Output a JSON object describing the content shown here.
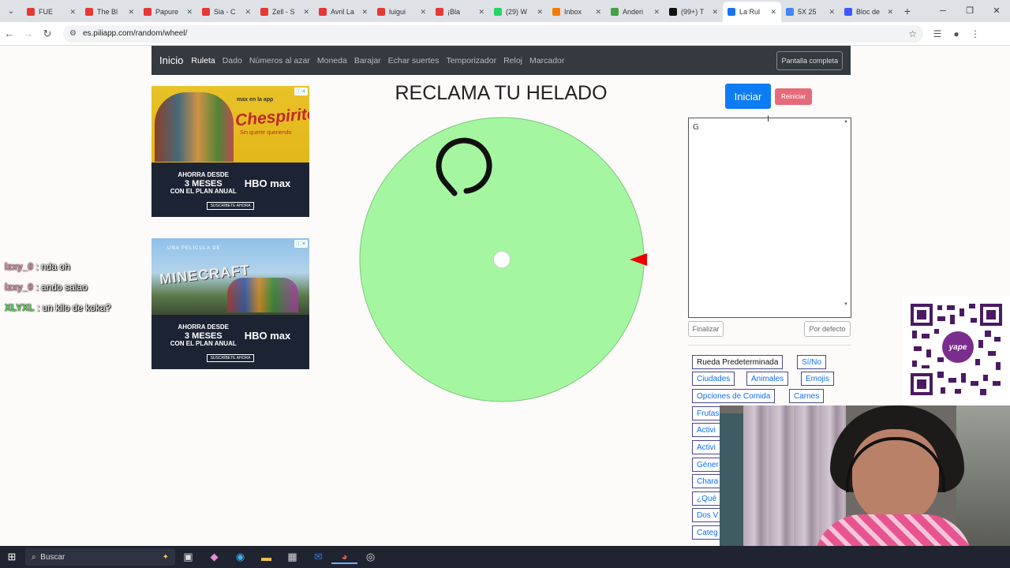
{
  "browser": {
    "tabs": [
      {
        "title": "FUE",
        "color": "#e53935"
      },
      {
        "title": "The Bl",
        "color": "#e53935"
      },
      {
        "title": "Papure",
        "color": "#e53935"
      },
      {
        "title": "Sia - C",
        "color": "#e53935"
      },
      {
        "title": "Zell - S",
        "color": "#e53935"
      },
      {
        "title": "Avril La",
        "color": "#e53935"
      },
      {
        "title": "luigui",
        "color": "#e53935"
      },
      {
        "title": "¡Bla",
        "color": "#e53935"
      },
      {
        "title": "(29) W",
        "color": "#25d366"
      },
      {
        "title": "Inbox",
        "color": "#f57c00"
      },
      {
        "title": "Anderi",
        "color": "#43a047"
      },
      {
        "title": "(99+) T",
        "color": "#111111"
      },
      {
        "title": "La Rul",
        "color": "#1a73e8"
      },
      {
        "title": "5X 25",
        "color": "#4285f4"
      },
      {
        "title": "Bloc de",
        "color": "#3d5afe"
      }
    ],
    "active_tab_index": 12,
    "url": "es.piliapp.com/random/wheel/"
  },
  "navbar": {
    "brand": "Inicio",
    "links": [
      "Ruleta",
      "Dado",
      "Números al azar",
      "Moneda",
      "Barajar",
      "Echar suertes",
      "Temporizador",
      "Reloj",
      "Marcador"
    ],
    "fullscreen": "Pantalla completa"
  },
  "ads": [
    {
      "mini": "max en la app",
      "title": "Chespirito",
      "tagline": "Sin querer queriendo",
      "offer_line1": "AHORRA DESDE",
      "offer_big": "3 MESES",
      "offer_line2": "CON EL PLAN ANUAL",
      "brand": "HBO max",
      "cta": "SUSCRÍBETE AHORA"
    },
    {
      "pre": "UNA PELÍCULA DE",
      "title": "MINECRAFT",
      "offer_line1": "AHORRA DESDE",
      "offer_big": "3 MESES",
      "offer_line2": "CON EL PLAN ANUAL",
      "brand": "HBO max",
      "cta": "SUSCRÍBETE AHORA"
    }
  ],
  "chat": [
    {
      "user": "lzxy_0",
      "message": ": nda oh",
      "color": "#e08aa0"
    },
    {
      "user": "lzxy_0",
      "message": ": ando salao",
      "color": "#e08aa0"
    },
    {
      "user": "XLYXL",
      "message": ": un kilo de koka?",
      "color": "#5ed05e"
    }
  ],
  "wheel": {
    "title": "RECLAMA TU HELADO",
    "fill_color": "#a4f7a0",
    "pointer_color": "#ee0000"
  },
  "controls": {
    "start": "Iniciar",
    "reset": "Reiniciar",
    "entries_value": "G",
    "finish": "Finalizar",
    "default": "Por defecto"
  },
  "presets": [
    "Rueda Predeterminada",
    "Sí/No",
    "Ciudades",
    "Animales",
    "Emojis",
    "Opciones de Comida",
    "Carnes",
    "Frutas",
    "Activi",
    "Activi",
    "Géner",
    "Chara",
    "¿Qué",
    "Dos V",
    "Categ"
  ],
  "qr": {
    "label": "yape"
  },
  "taskbar": {
    "search": "Buscar"
  }
}
